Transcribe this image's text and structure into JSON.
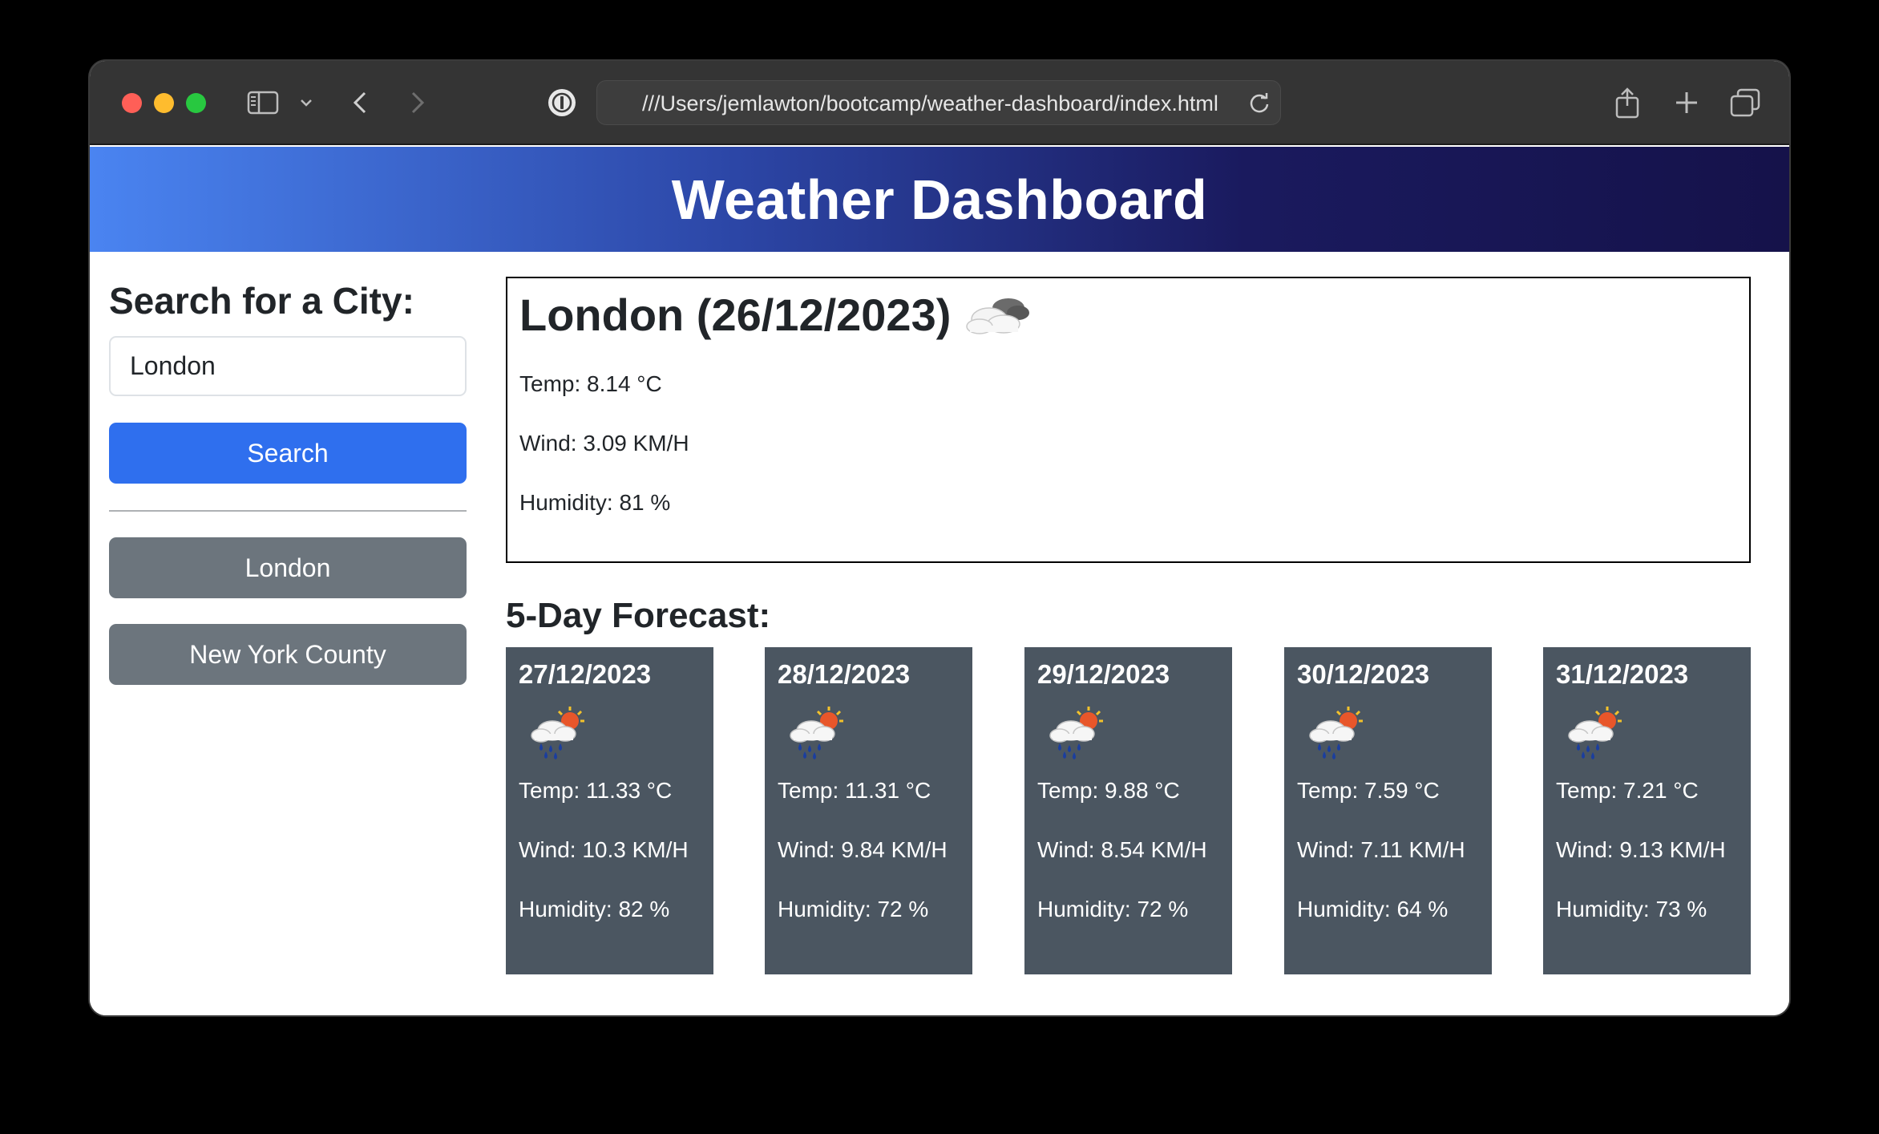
{
  "browser": {
    "url": "///Users/jemlawton/bootcamp/weather-dashboard/index.html"
  },
  "app": {
    "title": "Weather Dashboard"
  },
  "sidebar": {
    "heading": "Search for a City:",
    "input_value": "London",
    "search_label": "Search",
    "history": [
      "London",
      "New York County"
    ]
  },
  "current": {
    "title": "London (26/12/2023)",
    "icon": "cloudy-icon",
    "temp": "Temp: 8.14 °C",
    "wind": "Wind: 3.09 KM/H",
    "humidity": "Humidity: 81 %"
  },
  "forecast": {
    "title": "5-Day Forecast:",
    "days": [
      {
        "date": "27/12/2023",
        "icon": "rain-sun-icon",
        "temp": "Temp: 11.33 °C",
        "wind": "Wind: 10.3 KM/H",
        "humidity": "Humidity: 82 %"
      },
      {
        "date": "28/12/2023",
        "icon": "rain-sun-icon",
        "temp": "Temp: 11.31 °C",
        "wind": "Wind: 9.84 KM/H",
        "humidity": "Humidity: 72 %"
      },
      {
        "date": "29/12/2023",
        "icon": "rain-sun-icon",
        "temp": "Temp: 9.88 °C",
        "wind": "Wind: 8.54 KM/H",
        "humidity": "Humidity: 72 %"
      },
      {
        "date": "30/12/2023",
        "icon": "rain-sun-icon",
        "temp": "Temp: 7.59 °C",
        "wind": "Wind: 7.11 KM/H",
        "humidity": "Humidity: 64 %"
      },
      {
        "date": "31/12/2023",
        "icon": "rain-sun-icon",
        "temp": "Temp: 7.21 °C",
        "wind": "Wind: 9.13 KM/H",
        "humidity": "Humidity: 73 %"
      }
    ]
  },
  "colors": {
    "primary": "#2f6fee",
    "secondary": "#6c757d",
    "card": "#4b5661",
    "hero_start": "#4a84f1",
    "hero_end": "#15124a"
  }
}
